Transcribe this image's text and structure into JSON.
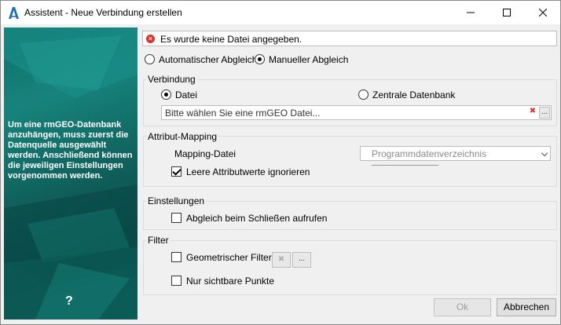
{
  "window": {
    "title": "Assistent - Neue Verbindung erstellen",
    "icons": {
      "app": "autodesk-a-icon",
      "minimize": "minimize-icon",
      "maximize": "maximize-icon",
      "close": "close-icon"
    }
  },
  "sidepanel": {
    "text": "Um eine rmGEO-Datenbank anzuhängen, muss zuerst die Datenquelle ausgewählt werden. Anschließend können die jeweiligen Einstellungen vorgenommen werden.",
    "help": "?"
  },
  "error": {
    "message": "Es wurde keine Datei angegeben.",
    "color": "#d9332e"
  },
  "mode": {
    "auto_label": "Automatischer Abgleich",
    "manual_label": "Manueller Abgleich",
    "selected": "manual"
  },
  "verbindung": {
    "title": "Verbindung",
    "datei_label": "Datei",
    "zentral_label": "Zentrale Datenbank",
    "selected": "datei",
    "file_placeholder": "Bitte wählen Sie eine rmGEO Datei...",
    "clear_icon": "red-x-icon",
    "browse_label": "..."
  },
  "mapping": {
    "title": "Attribut-Mapping",
    "file_label": "Mapping-Datei",
    "select_value": "Programmdatenverzeichnis",
    "ignore_label": "Leere Attributwerte ignorieren",
    "ignore_checked": true
  },
  "einstellungen": {
    "title": "Einstellungen",
    "close_sync_label": "Abgleich beim Schließen aufrufen",
    "close_sync_checked": false
  },
  "filter": {
    "title": "Filter",
    "geo_label": "Geometrischer Filter",
    "geo_checked": false,
    "visible_label": "Nur sichtbare Punkte",
    "visible_checked": false,
    "browse_label": "..."
  },
  "footer": {
    "ok_label": "Ok",
    "cancel_label": "Abbrechen"
  }
}
